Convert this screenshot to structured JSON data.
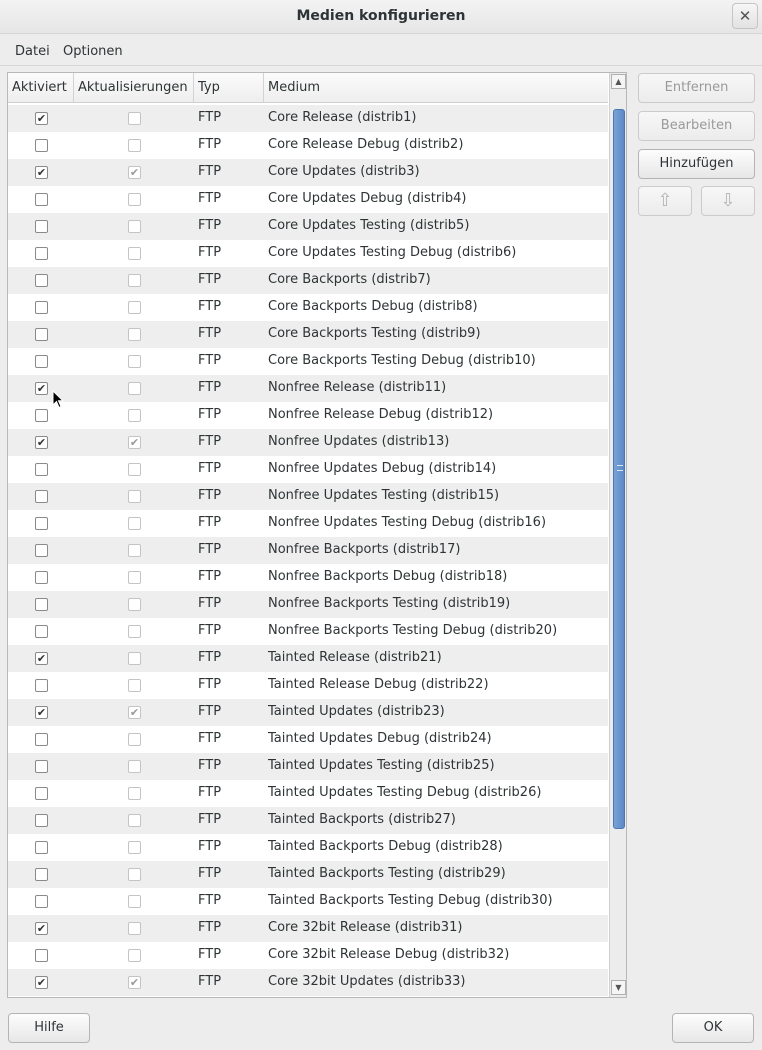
{
  "window": {
    "title": "Medien konfigurieren"
  },
  "menu": {
    "items": [
      "Datei",
      "Optionen"
    ]
  },
  "table": {
    "columns": [
      "Aktiviert",
      "Aktualisierungen",
      "Typ",
      "Medium"
    ],
    "rows": [
      {
        "active": true,
        "updates": false,
        "type": "FTP",
        "medium": "Core Release (distrib1)"
      },
      {
        "active": false,
        "updates": false,
        "type": "FTP",
        "medium": "Core Release Debug (distrib2)"
      },
      {
        "active": true,
        "updates": true,
        "type": "FTP",
        "medium": "Core Updates (distrib3)"
      },
      {
        "active": false,
        "updates": false,
        "type": "FTP",
        "medium": "Core Updates Debug (distrib4)"
      },
      {
        "active": false,
        "updates": false,
        "type": "FTP",
        "medium": "Core Updates Testing (distrib5)"
      },
      {
        "active": false,
        "updates": false,
        "type": "FTP",
        "medium": "Core Updates Testing Debug (distrib6)"
      },
      {
        "active": false,
        "updates": false,
        "type": "FTP",
        "medium": "Core Backports (distrib7)"
      },
      {
        "active": false,
        "updates": false,
        "type": "FTP",
        "medium": "Core Backports Debug (distrib8)"
      },
      {
        "active": false,
        "updates": false,
        "type": "FTP",
        "medium": "Core Backports Testing (distrib9)"
      },
      {
        "active": false,
        "updates": false,
        "type": "FTP",
        "medium": "Core Backports Testing Debug (distrib10)"
      },
      {
        "active": true,
        "updates": false,
        "type": "FTP",
        "medium": "Nonfree Release (distrib11)"
      },
      {
        "active": false,
        "updates": false,
        "type": "FTP",
        "medium": "Nonfree Release Debug (distrib12)"
      },
      {
        "active": true,
        "updates": true,
        "type": "FTP",
        "medium": "Nonfree Updates (distrib13)"
      },
      {
        "active": false,
        "updates": false,
        "type": "FTP",
        "medium": "Nonfree Updates Debug (distrib14)"
      },
      {
        "active": false,
        "updates": false,
        "type": "FTP",
        "medium": "Nonfree Updates Testing (distrib15)"
      },
      {
        "active": false,
        "updates": false,
        "type": "FTP",
        "medium": "Nonfree Updates Testing Debug (distrib16)"
      },
      {
        "active": false,
        "updates": false,
        "type": "FTP",
        "medium": "Nonfree Backports (distrib17)"
      },
      {
        "active": false,
        "updates": false,
        "type": "FTP",
        "medium": "Nonfree Backports Debug (distrib18)"
      },
      {
        "active": false,
        "updates": false,
        "type": "FTP",
        "medium": "Nonfree Backports Testing (distrib19)"
      },
      {
        "active": false,
        "updates": false,
        "type": "FTP",
        "medium": "Nonfree Backports Testing Debug (distrib20)"
      },
      {
        "active": true,
        "updates": false,
        "type": "FTP",
        "medium": "Tainted Release (distrib21)"
      },
      {
        "active": false,
        "updates": false,
        "type": "FTP",
        "medium": "Tainted Release Debug (distrib22)"
      },
      {
        "active": true,
        "updates": true,
        "type": "FTP",
        "medium": "Tainted Updates (distrib23)"
      },
      {
        "active": false,
        "updates": false,
        "type": "FTP",
        "medium": "Tainted Updates Debug (distrib24)"
      },
      {
        "active": false,
        "updates": false,
        "type": "FTP",
        "medium": "Tainted Updates Testing (distrib25)"
      },
      {
        "active": false,
        "updates": false,
        "type": "FTP",
        "medium": "Tainted Updates Testing Debug (distrib26)"
      },
      {
        "active": false,
        "updates": false,
        "type": "FTP",
        "medium": "Tainted Backports (distrib27)"
      },
      {
        "active": false,
        "updates": false,
        "type": "FTP",
        "medium": "Tainted Backports Debug (distrib28)"
      },
      {
        "active": false,
        "updates": false,
        "type": "FTP",
        "medium": "Tainted Backports Testing (distrib29)"
      },
      {
        "active": false,
        "updates": false,
        "type": "FTP",
        "medium": "Tainted Backports Testing Debug (distrib30)"
      },
      {
        "active": true,
        "updates": false,
        "type": "FTP",
        "medium": "Core 32bit Release (distrib31)"
      },
      {
        "active": false,
        "updates": false,
        "type": "FTP",
        "medium": "Core 32bit Release Debug (distrib32)"
      },
      {
        "active": true,
        "updates": true,
        "type": "FTP",
        "medium": "Core 32bit Updates (distrib33)"
      }
    ]
  },
  "buttons": {
    "remove": "Entfernen",
    "edit": "Bearbeiten",
    "add": "Hinzufügen",
    "help": "Hilfe",
    "ok": "OK"
  },
  "icons": {
    "close": "close-icon",
    "move_up": "arrow-up-icon",
    "move_down": "arrow-down-icon"
  },
  "colors": {
    "scrollbar_thumb": "#5b89c5"
  }
}
